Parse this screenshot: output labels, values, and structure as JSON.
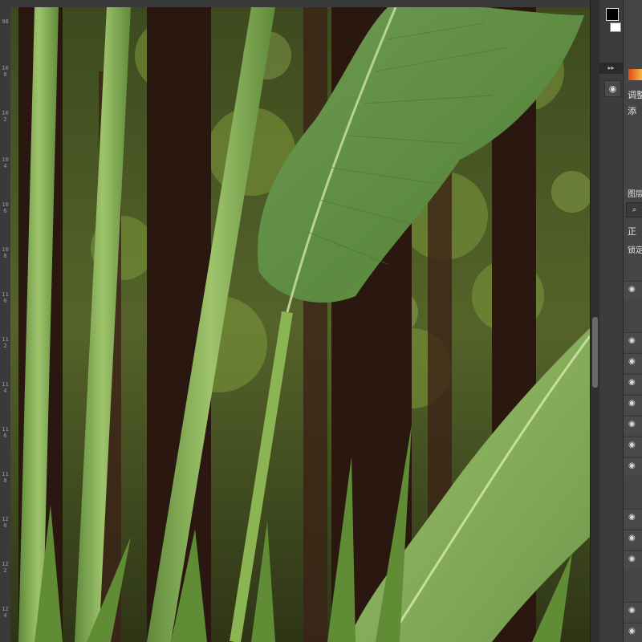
{
  "ruler": {
    "left_labels": [
      "98",
      "100",
      "102",
      "104",
      "106",
      "108",
      "110",
      "112",
      "114",
      "116",
      "118",
      "120",
      "122",
      "124"
    ]
  },
  "colors": {
    "foreground": "#000000",
    "background": "#ffffff"
  },
  "panel": {
    "label_adjust": "调整",
    "label_styles": "添",
    "label_layers": "图层",
    "label_normal": "正",
    "label_lock": "锁定"
  },
  "icons": [
    "eye-icon",
    "search-icon",
    "collapse-icon",
    "adjustments-icon"
  ]
}
